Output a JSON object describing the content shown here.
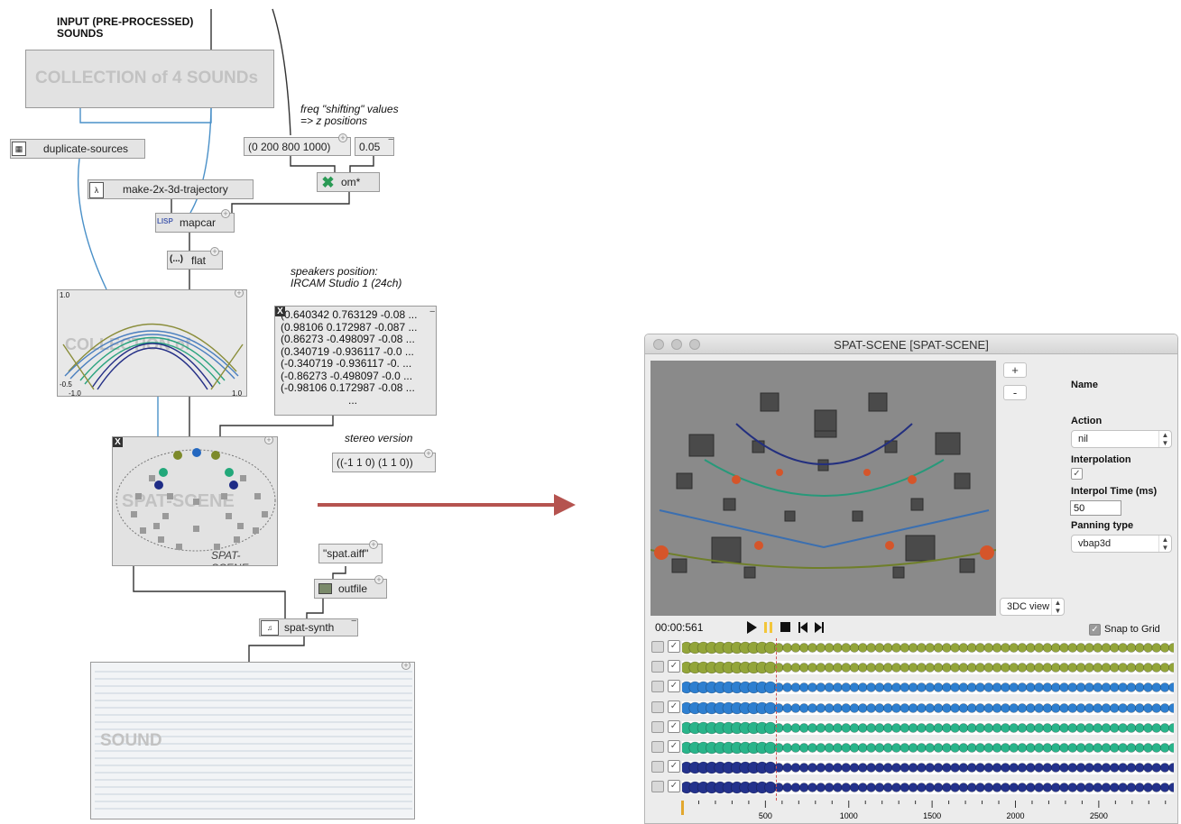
{
  "patch": {
    "title_note": "INPUT (PRE-PROCESSED)\nSOUNDS",
    "collection_box": {
      "label": "COLLECTION of 4 SOUNDs"
    },
    "duplicate_sources": {
      "label": "duplicate-sources"
    },
    "trajectory": {
      "label": "make-2x-3d-trajectory"
    },
    "freq_note": "freq \"shifting\" values\n=> z positions",
    "freq_values": {
      "label": "(0 200 800 1000)"
    },
    "factor": {
      "label": "0.05"
    },
    "om_times": {
      "label": "om*"
    },
    "mapcar": {
      "label": "mapcar",
      "badge": "LISP"
    },
    "flat": {
      "label": "flat",
      "badge": "(...)"
    },
    "traj_collection": {
      "watermark": "COLLECTION of",
      "y_max": "1.0",
      "y_min": "-0.5",
      "x_min": "-1.0",
      "x_max": "1.0"
    },
    "speakers_note": "speakers position:\nIRCAM Studio 1 (24ch)",
    "speakers_list": {
      "rows": [
        "(0.640342 0.763129 -0.08 ...",
        "(0.98106 0.172987 -0.087 ...",
        "(0.86273 -0.498097 -0.08 ...",
        "(0.340719 -0.936117 -0.0 ...",
        "(-0.340719 -0.936117 -0. ...",
        "(-0.86273 -0.498097 -0.0 ...",
        "(-0.98106 0.172987 -0.08 ..."
      ],
      "ellipsis": "..."
    },
    "stereo_note": "stereo version",
    "stereo_values": {
      "label": "((-1 1 0) (1 1 0))"
    },
    "spat_scene_box": {
      "watermark": "SPAT-SCENE",
      "caption": "SPAT-SCENE"
    },
    "filename": {
      "label": "\"spat.aiff\""
    },
    "outfile": {
      "label": "outfile"
    },
    "spat_synth": {
      "label": "spat-synth"
    },
    "sound_box": {
      "watermark": "SOUND"
    },
    "arrow_color": "#b5534f"
  },
  "window": {
    "title": "SPAT-SCENE [SPAT-SCENE]",
    "zoom_in_label": "+",
    "zoom_out_label": "-",
    "view_mode": "3DC view",
    "time_display": "00:00:561",
    "snap_to_grid_label": "Snap to Grid",
    "snap_to_grid": true,
    "props": {
      "name_label": "Name",
      "action_label": "Action",
      "action_value": "nil",
      "interpolation_label": "Interpolation",
      "interpolation": true,
      "interpol_time_label": "Interpol Time (ms)",
      "interpol_time_value": "50",
      "panning_label": "Panning type",
      "panning_value": "vbap3d"
    },
    "transport": {
      "play": "play-icon",
      "pause": "pause-icon",
      "stop": "stop-icon",
      "prev": "skip-start-icon",
      "next": "skip-end-icon"
    },
    "tracks": [
      {
        "color": "#93a53a",
        "enabled": true
      },
      {
        "color": "#93a53a",
        "enabled": true
      },
      {
        "color": "#2e7fd0",
        "enabled": true
      },
      {
        "color": "#2e7fd0",
        "enabled": true
      },
      {
        "color": "#29b48a",
        "enabled": true
      },
      {
        "color": "#29b48a",
        "enabled": true
      },
      {
        "color": "#24328c",
        "enabled": true
      },
      {
        "color": "#24328c",
        "enabled": true
      }
    ],
    "ruler_labels": [
      "500",
      "1000",
      "1500",
      "2000",
      "2500"
    ],
    "cursor_ms": 561
  }
}
